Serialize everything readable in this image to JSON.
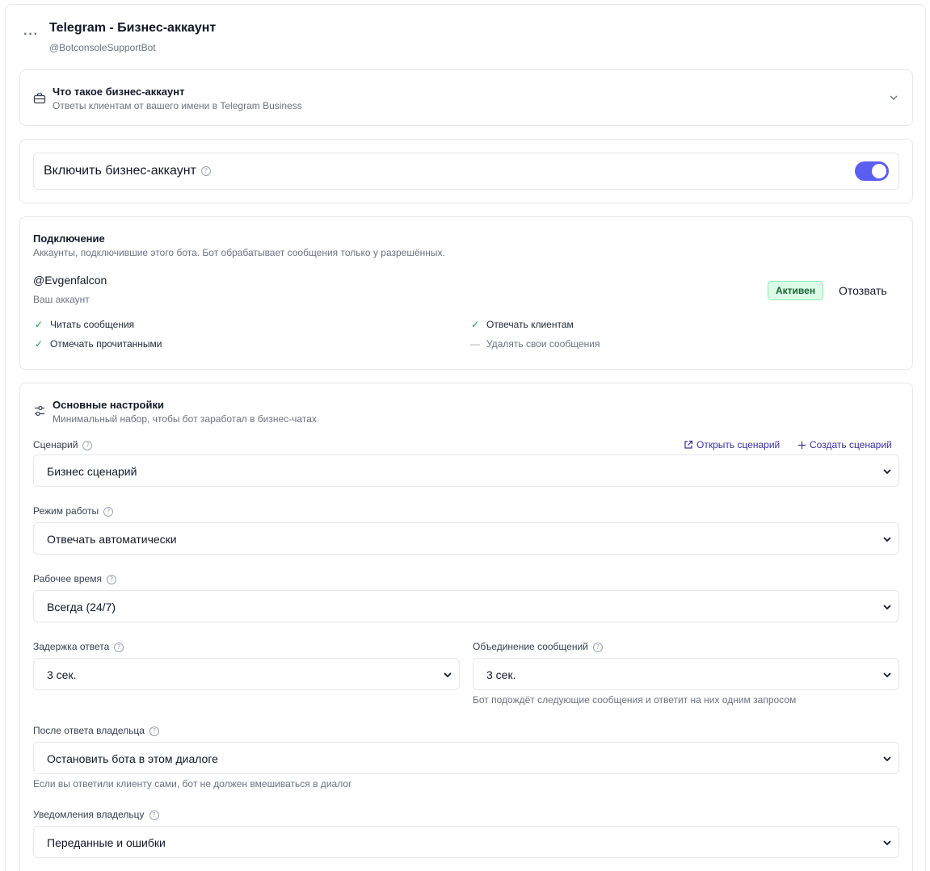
{
  "header": {
    "menu_icon": "more-horizontal-icon",
    "title": "Telegram - Бизнес-аккаунт",
    "subtitle": "@BotconsoleSupportBot"
  },
  "info_card": {
    "icon": "briefcase-icon",
    "title": "Что такое бизнес-аккаунт",
    "description": "Ответы клиентам от вашего имени в Telegram Business",
    "expand_icon": "chevron-down-icon"
  },
  "toggle_card": {
    "label": "Включить бизнес-аккаунт",
    "help": "?",
    "enabled": true,
    "accent_color": "#5b5ef0"
  },
  "connection": {
    "title": "Подключение",
    "description": "Аккаунты, подключившие этого бота. Бот обрабатывает сообщения только у разрешённых.",
    "account": "@Evgenfalcon",
    "account_note": "Ваш аккаунт",
    "status": "Активен",
    "revoke_label": "Отозвать",
    "permissions": [
      {
        "label": "Читать сообщения",
        "granted": true,
        "mark": "✓"
      },
      {
        "label": "Отвечать клиентам",
        "granted": true,
        "mark": "✓"
      },
      {
        "label": "Отмечать прочитанными",
        "granted": true,
        "mark": "✓"
      },
      {
        "label": "Удалять свои сообщения",
        "granted": false,
        "mark": "—"
      }
    ]
  },
  "settings": {
    "icon": "sliders-icon",
    "title": "Основные настройки",
    "description": "Минимальный набор, чтобы бот заработал в бизнес-чатах",
    "scenario": {
      "label": "Сценарий",
      "value": "Бизнес сценарий",
      "open_link": "Открыть сценарий",
      "create_link": "Создать сценарий"
    },
    "mode": {
      "label": "Режим работы",
      "value": "Отвечать автоматически"
    },
    "work_time": {
      "label": "Рабочее время",
      "value": "Всегда (24/7)"
    },
    "delay": {
      "label": "Задержка ответа",
      "value": "3 сек."
    },
    "merge": {
      "label": "Объединение сообщений",
      "value": "3 сек.",
      "hint": "Бот подождёт следующие сообщения и ответит на них одним запросом"
    },
    "after_owner": {
      "label": "После ответа владельца",
      "value": "Остановить бота в этом диалоге",
      "hint": "Если вы ответили клиенту сами, бот не должен вмешиваться в диалог"
    },
    "notifications": {
      "label": "Уведомления владельцу",
      "value": "Переданные и ошибки"
    }
  }
}
